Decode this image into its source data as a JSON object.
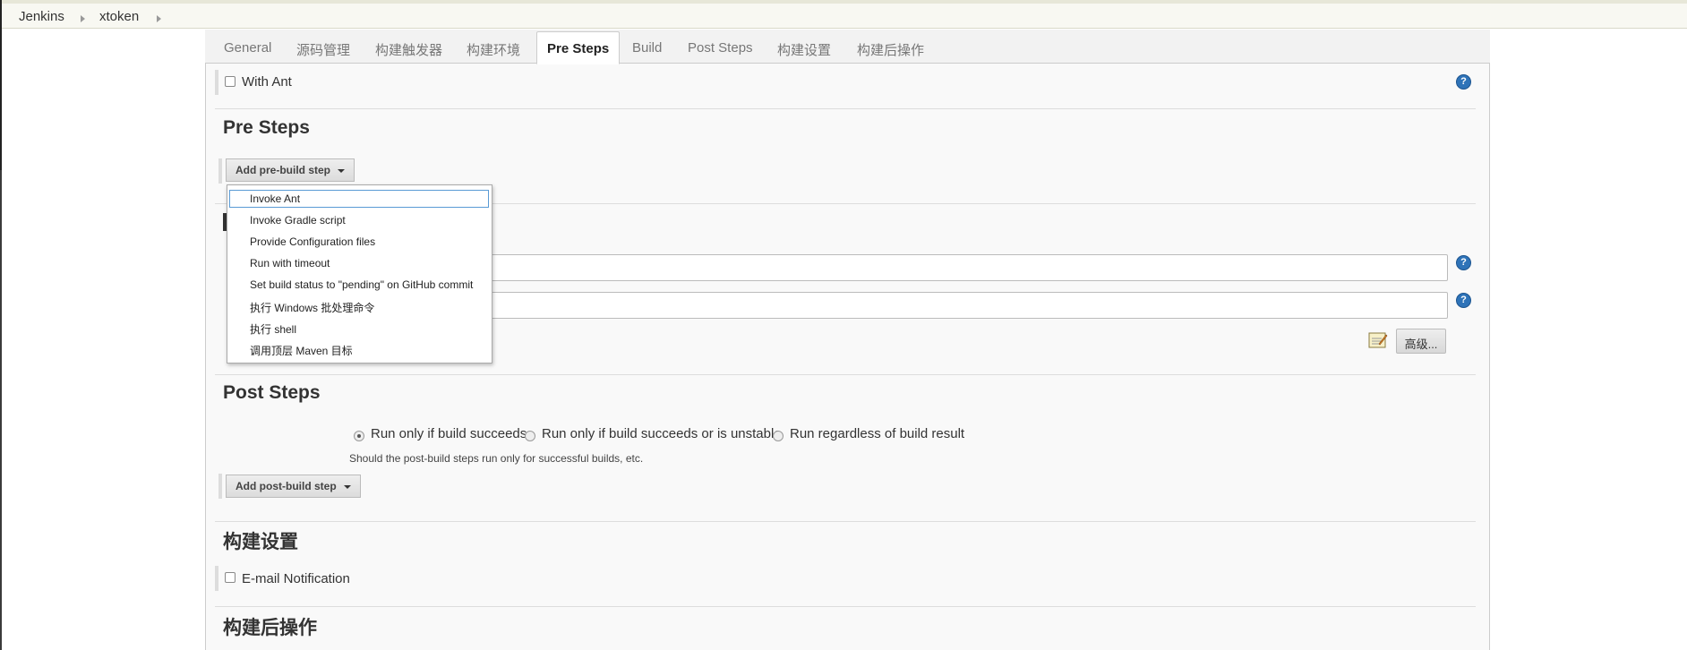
{
  "breadcrumb": [
    {
      "label": "Jenkins"
    },
    {
      "label": "xtoken"
    }
  ],
  "tabs": [
    {
      "label": "General"
    },
    {
      "label": "源码管理"
    },
    {
      "label": "构建触发器"
    },
    {
      "label": "构建环境"
    },
    {
      "label": "Pre Steps",
      "active": true
    },
    {
      "label": "Build"
    },
    {
      "label": "Post Steps"
    },
    {
      "label": "构建设置"
    },
    {
      "label": "构建后操作"
    }
  ],
  "build_env": {
    "with_ant_label": "With Ant",
    "with_ant_checked": false
  },
  "pre_steps": {
    "title": "Pre Steps",
    "add_button": "Add pre-build step",
    "menu_items": [
      "Invoke Ant",
      "Invoke Gradle script",
      "Provide Configuration files",
      "Run with timeout",
      "Set build status to \"pending\" on GitHub commit",
      "执行 Windows 批处理命令",
      "执行 shell",
      "调用顶层 Maven 目标"
    ]
  },
  "build": {
    "advanced_button": "高级..."
  },
  "post_steps": {
    "title": "Post Steps",
    "options": [
      {
        "label": "Run only if build succeeds",
        "checked": true
      },
      {
        "label": "Run only if build succeeds or is unstable",
        "checked": false
      },
      {
        "label": "Run regardless of build result",
        "checked": false
      }
    ],
    "hint": "Should the post-build steps run only for successful builds, etc.",
    "add_button": "Add post-build step"
  },
  "build_settings": {
    "title": "构建设置",
    "email_label": "E-mail Notification",
    "email_checked": false
  },
  "post_build": {
    "title": "构建后操作"
  },
  "colors": {
    "help_icon": "#2e73b8",
    "menu_focus_border": "#5a9bd5",
    "panel_bg": "#f9f9f9"
  }
}
